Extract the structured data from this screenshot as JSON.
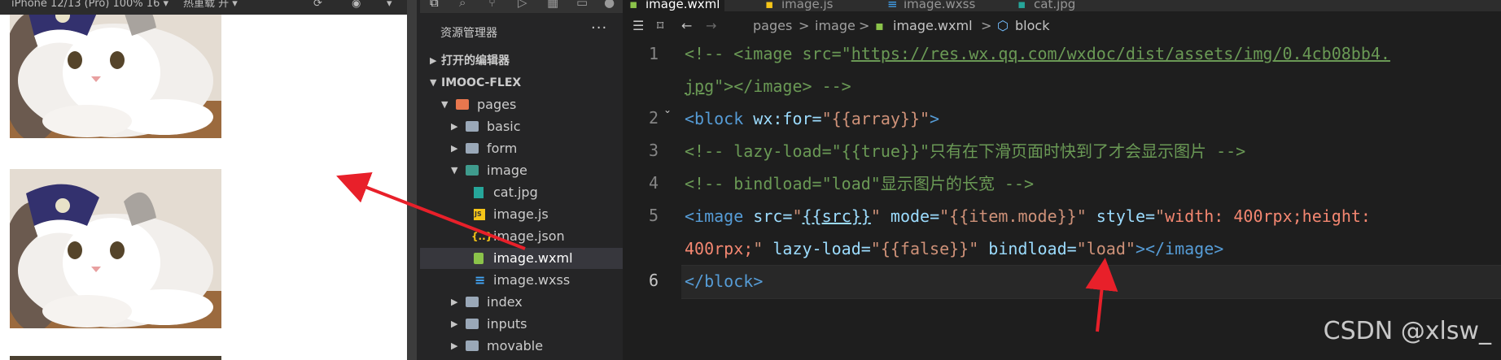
{
  "simulator": {
    "device_label": "iPhone 12/13 (Pro) 100% 16 ▾",
    "hot_reload_label": "热重载 开 ▾"
  },
  "explorer": {
    "title": "资源管理器",
    "more": "···",
    "open_editors": "打开的编辑器",
    "project": "IMOOC-FLEX",
    "tree": [
      {
        "label": "pages"
      },
      {
        "label": "basic"
      },
      {
        "label": "form"
      },
      {
        "label": "image"
      },
      {
        "label": "cat.jpg"
      },
      {
        "label": "image.js"
      },
      {
        "label": "image.json"
      },
      {
        "label": "image.wxml"
      },
      {
        "label": "image.wxss"
      },
      {
        "label": "index"
      },
      {
        "label": "inputs"
      },
      {
        "label": "movable"
      }
    ],
    "js_badge": "JS",
    "json_badge": "{..}"
  },
  "tabs": [
    {
      "label": "image.wxml"
    },
    {
      "label": "image.js"
    },
    {
      "label": "image.wxss"
    },
    {
      "label": "cat.jpg"
    }
  ],
  "breadcrumb": {
    "pages": "pages",
    "image": "image",
    "file": "image.wxml",
    "symbol": "block",
    "sep": ">"
  },
  "line_numbers": [
    "1",
    "2",
    "3",
    "4",
    "5",
    "6"
  ],
  "code": {
    "l1a_pre": "<!-- <image src=\"",
    "l1a_url": "https://res.wx.qq.com/wxdoc/dist/assets/img/0.4cb08bb4.",
    "l1b_url": "jpg",
    "l1b_post": "\"></image> -->",
    "l2_open": "<",
    "l2_tag": "block",
    "l2_attr": " wx:for=",
    "l2_val": "\"{{array}}\"",
    "l2_close": ">",
    "l3": "<!-- lazy-load=\"{{true}}\"只有在下滑页面时快到了才会显示图片 -->",
    "l4": "<!-- bindload=\"load\"显示图片的长宽 -->",
    "l5_open": "<",
    "l5_tag": "image",
    "l5_src_attr": " src=",
    "l5_q1": "\"",
    "l5_src_val": "{{src}}",
    "l5_q2": "\"",
    "l5_mode_attr": " mode=",
    "l5_mode_val": "\"{{item.mode}}\"",
    "l5_style_attr": " style=",
    "l5_q3": "\"",
    "l5_style_val": "width: 400rpx;height:",
    "l6_style_val": "400rpx;",
    "l6_q4": "\"",
    "l6_lazy_attr": " lazy-load=",
    "l6_lazy_val": "\"{{false}}\"",
    "l6_bind_attr": " bindload=",
    "l6_q5": "\"",
    "l6_bind_val": "load",
    "l6_q6": "\"",
    "l6_end": "></image>",
    "l7_open": "</",
    "l7_tag": "block",
    "l7_close": ">"
  },
  "watermark": "CSDN @xlsw_",
  "colors": {
    "arrow": "#e8202a",
    "editor_bg": "#1e1e1e",
    "sidebar_bg": "#252526"
  }
}
